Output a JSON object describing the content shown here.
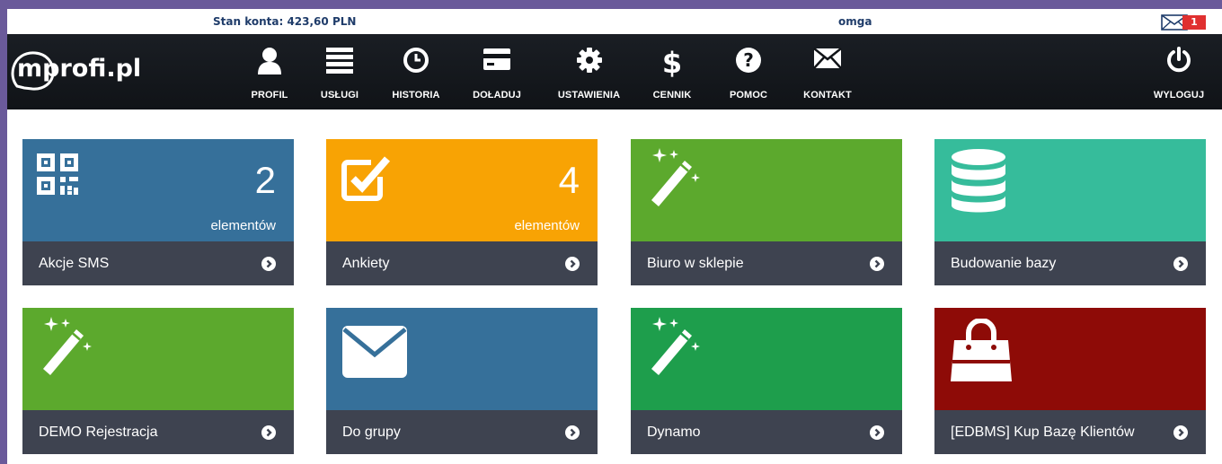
{
  "topbar": {
    "balance": "Stan konta: 423,60 PLN",
    "user": "omga",
    "mail_count": "1"
  },
  "navbar": {
    "logo_icon": "mprofi-logo-icon",
    "items": [
      {
        "label": "PROFIL",
        "icon": "user-icon"
      },
      {
        "label": "USŁUGI",
        "icon": "list-icon"
      },
      {
        "label": "HISTORIA",
        "icon": "clock-icon"
      },
      {
        "label": "DOŁADUJ",
        "icon": "credit-card-icon"
      },
      {
        "label": "USTAWIENIA",
        "icon": "gear-icon"
      },
      {
        "label": "CENNIK",
        "icon": "dollar-icon"
      },
      {
        "label": "POMOC",
        "icon": "question-icon"
      },
      {
        "label": "KONTAKT",
        "icon": "envelope-icon"
      },
      {
        "label": "WYLOGUJ",
        "icon": "power-icon"
      }
    ]
  },
  "tiles": [
    {
      "label": "Akcje SMS",
      "count": "2",
      "unit": "elementów",
      "color": "#36709a",
      "icon": "qr-code-icon"
    },
    {
      "label": "Ankiety",
      "count": "4",
      "unit": "elementów",
      "color": "#f8a304",
      "icon": "checkbox-icon"
    },
    {
      "label": "Biuro w sklepie",
      "color": "#5ca92d",
      "icon": "magic-wand-icon"
    },
    {
      "label": "Budowanie bazy",
      "color": "#36bc9b",
      "icon": "database-icon"
    },
    {
      "label": "DEMO Rejestracja",
      "color": "#5ca92d",
      "icon": "magic-wand-icon"
    },
    {
      "label": "Do grupy",
      "color": "#36709a",
      "icon": "envelope-icon"
    },
    {
      "label": "Dynamo",
      "color": "#1e9e4c",
      "icon": "magic-wand-icon"
    },
    {
      "label": "[EDBMS] Kup Bazę Klientów",
      "color": "#8e0b07",
      "icon": "shopping-bag-icon"
    }
  ]
}
